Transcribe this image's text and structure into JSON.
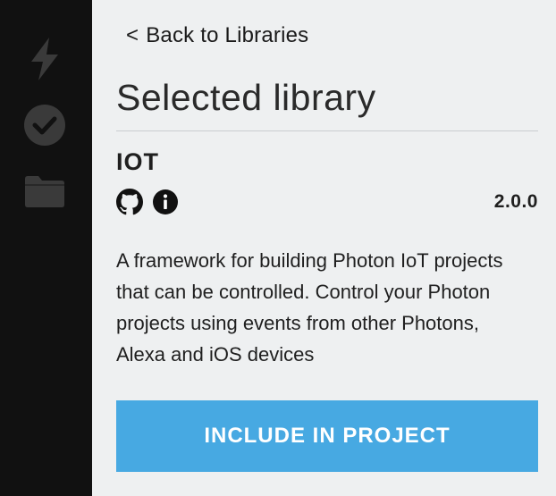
{
  "sidebar": {
    "items": [
      {
        "icon": "lightning-icon",
        "name": "flash"
      },
      {
        "icon": "check-circle-icon",
        "name": "verify"
      },
      {
        "icon": "folder-icon",
        "name": "files"
      }
    ],
    "icon_color": "#3a3a3a"
  },
  "panel": {
    "back_chevron": "<",
    "back_label": "Back to Libraries",
    "title": "Selected library",
    "library": {
      "name": "IOT",
      "version": "2.0.0",
      "description": "A framework for building Photon IoT projects that can be controlled. Control your Photon projects using events from other Photons, Alexa and iOS devices",
      "icons": [
        "github-icon",
        "info-icon"
      ]
    },
    "include_button_label": "INCLUDE IN PROJECT"
  },
  "colors": {
    "sidebar_bg": "#111111",
    "panel_bg": "#eef0f1",
    "accent": "#47a9e2",
    "text": "#1f1f1f"
  }
}
